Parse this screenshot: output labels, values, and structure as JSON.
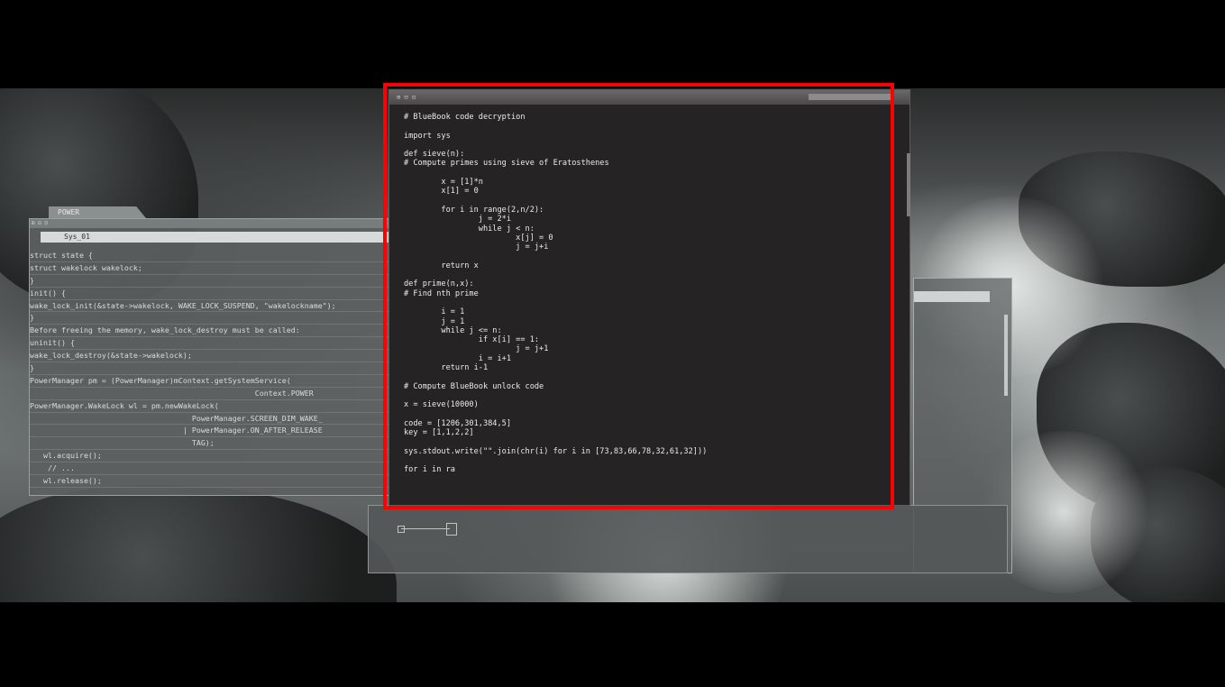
{
  "left_window": {
    "tab_label": "POWER",
    "chrome_label": "⊞ ⊟ ⊡",
    "selected_item": "Sys_01",
    "code_lines": [
      "struct state {",
      "struct wakelock wakelock;",
      "}",
      "init() {",
      "wake_lock_init(&state->wakelock, WAKE_LOCK_SUSPEND, \"wakelockname\");",
      "}",
      "Before freeing the memory, wake_lock_destroy must be called:",
      "uninit() {",
      "wake_lock_destroy(&state->wakelock);",
      "}",
      "PowerManager pm = (PowerManager)mContext.getSystemService(",
      "                                                  Context.POWER",
      "PowerManager.WakeLock wl = pm.newWakeLock(",
      "                                    PowerManager.SCREEN_DIM_WAKE_",
      "                                  | PowerManager.ON_AFTER_RELEASE",
      "                                    TAG);",
      "   wl.acquire();",
      "    // ...",
      "   wl.release();"
    ]
  },
  "terminal": {
    "chrome_label": "⊞ ⊟ ⊡",
    "code_lines": [
      "# BlueBook code decryption",
      "",
      "import sys",
      "",
      "def sieve(n):",
      "# Compute primes using sieve of Eratosthenes",
      "",
      "        x = [1]*n",
      "        x[1] = 0",
      "",
      "        for i in range(2,n/2):",
      "                j = 2*i",
      "                while j < n:",
      "                        x[j] = 0",
      "                        j = j+i",
      "",
      "        return x",
      "",
      "def prime(n,x):",
      "# Find nth prime",
      "",
      "        i = 1",
      "        j = 1",
      "        while j <= n:",
      "                if x[i] == 1:",
      "                        j = j+1",
      "                i = i+1",
      "        return i-1",
      "",
      "# Compute BlueBook unlock code",
      "",
      "x = sieve(10000)",
      "",
      "code = [1206,301,384,5]",
      "key = [1,1,2,2]",
      "",
      "sys.stdout.write(\"\".join(chr(i) for i in [73,83,66,78,32,61,32]))",
      "",
      "for i in ra"
    ]
  },
  "colors": {
    "highlight": "#ff0000",
    "terminal_bg": "#252323",
    "panel_bg": "#5c6060"
  }
}
